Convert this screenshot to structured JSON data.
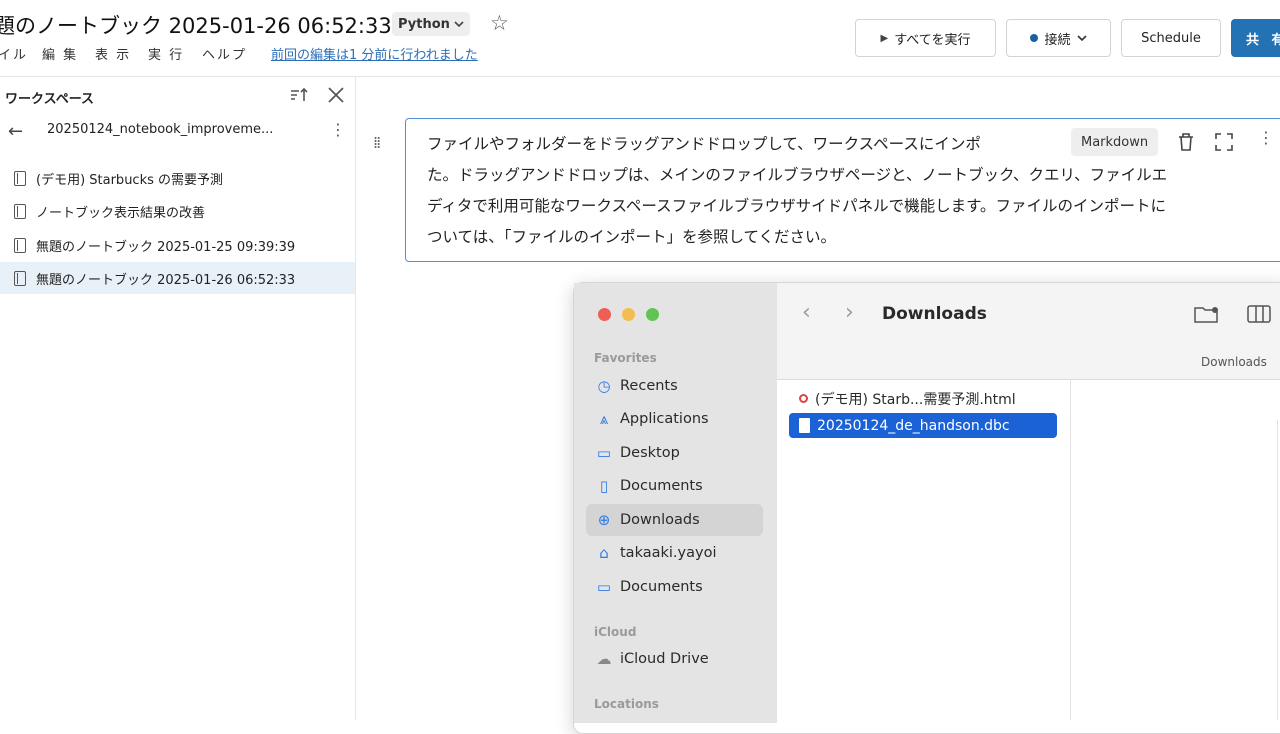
{
  "header": {
    "title": "題のノートブック 2025-01-26 06:52:33",
    "language": "Python",
    "menu": [
      "イル",
      "編 集",
      "表 示",
      "実 行",
      "ヘルプ"
    ],
    "last_edit": "前回の編集は1 分前に行われました",
    "run_all": "すべてを実行",
    "connect": "接続",
    "schedule": "Schedule",
    "share": "共 有"
  },
  "sidebar": {
    "title": "ワークスペース",
    "folder": "20250124_notebook_improveme...",
    "items": [
      {
        "label": "(デモ用) Starbucks の需要予測",
        "active": false
      },
      {
        "label": "ノートブック表示結果の改善",
        "active": false
      },
      {
        "label": "無題のノートブック 2025-01-25 09:39:39",
        "active": false
      },
      {
        "label": "無題のノートブック 2025-01-26 06:52:33",
        "active": true
      }
    ]
  },
  "cell": {
    "badge": "Markdown",
    "lines": [
      "ファイルやフォルダーをドラッグアンドドロップして、ワークスペースにインポ",
      "た。ドラッグアンドドロップは、メインのファイルブラウザページと、ノートブック、クエリ、ファイルエ",
      "ディタで利用可能なワークスペースファイルブラウザサイドパネルで機能します。ファイルのインポートに",
      "ついては、「ファイルのインポート」を参照してください。"
    ]
  },
  "finder": {
    "location": "Downloads",
    "path": "Downloads",
    "sidebar": {
      "favorites_heading": "Favorites",
      "favorites": [
        {
          "label": "Recents",
          "icon": "clock-icon"
        },
        {
          "label": "Applications",
          "icon": "applications-icon"
        },
        {
          "label": "Desktop",
          "icon": "desktop-icon"
        },
        {
          "label": "Documents",
          "icon": "document-icon"
        },
        {
          "label": "Downloads",
          "icon": "download-icon"
        },
        {
          "label": "takaaki.yayoi",
          "icon": "home-icon"
        },
        {
          "label": "Documents",
          "icon": "folder-icon"
        }
      ],
      "icloud_heading": "iCloud",
      "icloud": [
        {
          "label": "iCloud Drive",
          "icon": "cloud-icon"
        }
      ],
      "locations_heading": "Locations"
    },
    "files": [
      {
        "name": "(デモ用) Starb...需要予測.html",
        "selected": false
      },
      {
        "name": "20250124_de_handson.dbc",
        "selected": true
      }
    ]
  },
  "colors": {
    "accent": "#2272b4",
    "cell_border": "#4e8fd6",
    "finder_select": "#1a62d6"
  }
}
